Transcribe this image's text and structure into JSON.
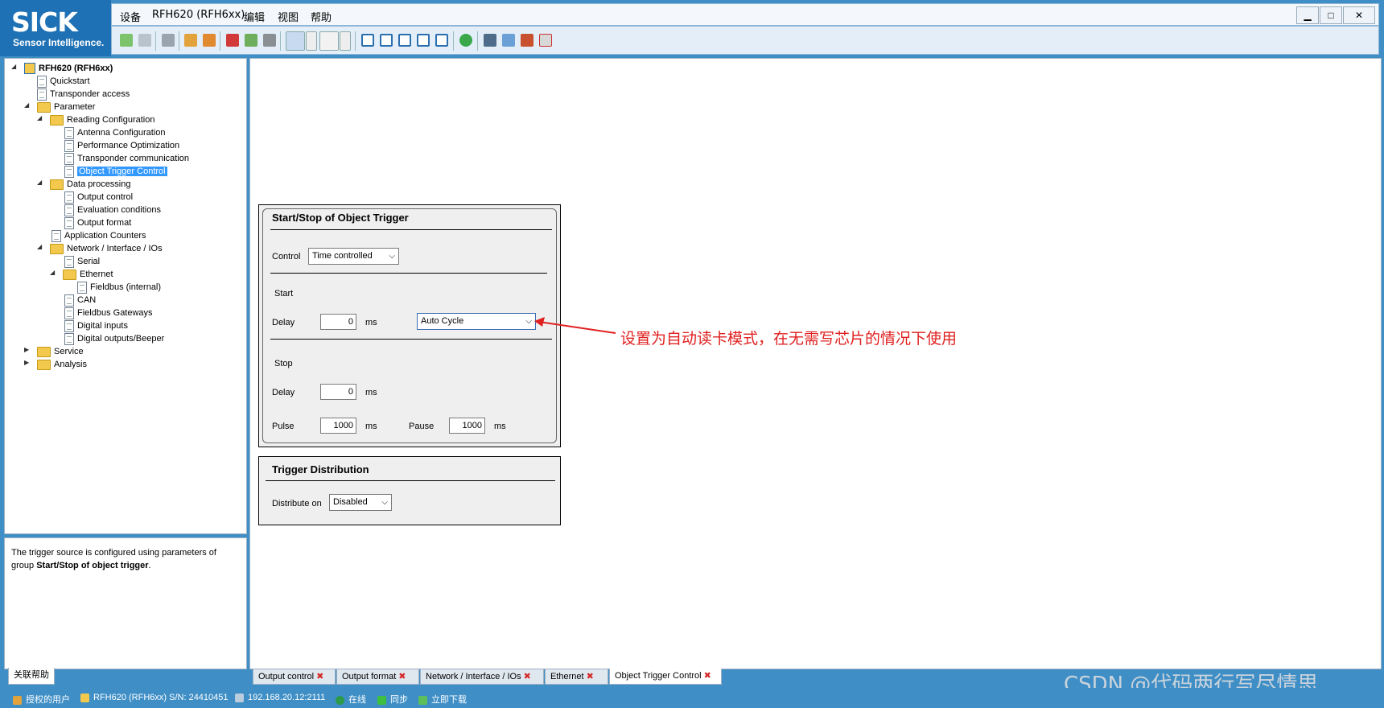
{
  "logo": {
    "brand": "SICK",
    "tagline": "Sensor Intelligence."
  },
  "menu": [
    "设备",
    "RFH620 (RFH6xx)",
    "编辑",
    "视图",
    "帮助"
  ],
  "window_controls": {
    "minimize": "▁",
    "maximize": "□",
    "close": "✕"
  },
  "toolbar": {
    "icons": [
      "back-arrow-icon",
      "forward-arrow-icon",
      "print-icon",
      "user-login-icon",
      "users-icon",
      "pdf-export-icon",
      "import-icon",
      "tag-icon",
      "connect-icon",
      "dropdown",
      "disconnect-icon",
      "dropdown",
      "layout-single-icon",
      "layout-split-h-icon",
      "layout-split-v-icon",
      "layout-quad-icon",
      "layout-grid-icon",
      "help-icon",
      "monitor-icon",
      "home-icon",
      "tools-icon",
      "report-icon"
    ]
  },
  "tree": [
    {
      "label": "RFH620 (RFH6xx)",
      "level": 0,
      "type": "device",
      "expanded": true,
      "bold": true
    },
    {
      "label": "Quickstart",
      "level": 1,
      "type": "doc"
    },
    {
      "label": "Transponder access",
      "level": 1,
      "type": "doc"
    },
    {
      "label": "Parameter",
      "level": 1,
      "type": "folder",
      "expanded": true
    },
    {
      "label": "Reading Configuration",
      "level": 2,
      "type": "folder",
      "expanded": true
    },
    {
      "label": "Antenna Configuration",
      "level": 3,
      "type": "doc"
    },
    {
      "label": "Performance Optimization",
      "level": 3,
      "type": "doc"
    },
    {
      "label": "Transponder communication",
      "level": 3,
      "type": "doc"
    },
    {
      "label": "Object Trigger Control",
      "level": 3,
      "type": "doc",
      "selected": true
    },
    {
      "label": "Data processing",
      "level": 2,
      "type": "folder",
      "expanded": true
    },
    {
      "label": "Output control",
      "level": 3,
      "type": "doc"
    },
    {
      "label": "Evaluation conditions",
      "level": 3,
      "type": "doc"
    },
    {
      "label": "Output format",
      "level": 3,
      "type": "doc"
    },
    {
      "label": "Application Counters",
      "level": 2,
      "type": "doc"
    },
    {
      "label": "Network / Interface / IOs",
      "level": 2,
      "type": "folder",
      "expanded": true
    },
    {
      "label": "Serial",
      "level": 3,
      "type": "doc"
    },
    {
      "label": "Ethernet",
      "level": 3,
      "type": "folder",
      "expanded": true
    },
    {
      "label": "Fieldbus (internal)",
      "level": 4,
      "type": "doc"
    },
    {
      "label": "CAN",
      "level": 3,
      "type": "doc"
    },
    {
      "label": "Fieldbus Gateways",
      "level": 3,
      "type": "doc"
    },
    {
      "label": "Digital inputs",
      "level": 3,
      "type": "doc"
    },
    {
      "label": "Digital outputs/Beeper",
      "level": 3,
      "type": "doc"
    },
    {
      "label": "Service",
      "level": 1,
      "type": "folder",
      "expanded": false
    },
    {
      "label": "Analysis",
      "level": 1,
      "type": "folder",
      "expanded": false
    }
  ],
  "help": {
    "text1": "The trigger source is configured using parameters of",
    "text2_prefix": "group ",
    "text2_bold": "Start/Stop of object trigger",
    "text2_suffix": ".",
    "tab": "关联帮助"
  },
  "object_trigger": {
    "title": "Start/Stop of Object Trigger",
    "control_label": "Control",
    "control_value": "Time controlled",
    "start_label": "Start",
    "start_delay_label": "Delay",
    "start_delay_value": "0",
    "start_delay_unit": "ms",
    "start_mode_value": "Auto Cycle",
    "stop_label": "Stop",
    "stop_delay_label": "Delay",
    "stop_delay_value": "0",
    "stop_delay_unit": "ms",
    "pulse_label": "Pulse",
    "pulse_value": "1000",
    "pulse_unit": "ms",
    "pause_label": "Pause",
    "pause_value": "1000",
    "pause_unit": "ms"
  },
  "trigger_distribution": {
    "title": "Trigger Distribution",
    "distribute_label": "Distribute on",
    "distribute_value": "Disabled"
  },
  "annotation": "设置为自动读卡模式，在无需写芯片的情况下使用",
  "tabs": [
    {
      "label": "Output control",
      "active": false
    },
    {
      "label": "Output format",
      "active": false
    },
    {
      "label": "Network / Interface / IOs",
      "active": false
    },
    {
      "label": "Ethernet",
      "active": false
    },
    {
      "label": "Object Trigger Control",
      "active": true
    }
  ],
  "status": {
    "user": "授权的用户",
    "device": "RFH620 (RFH6xx) S/N: 24410451",
    "ip": "192.168.20.12:2111",
    "online": "在线",
    "sync": "同步",
    "download": "立即下载"
  },
  "watermark": "CSDN @代码两行写尽情思",
  "colors": {
    "accent": "#3f8fc6",
    "selection": "#3399ff",
    "annotation": "#e02020"
  }
}
